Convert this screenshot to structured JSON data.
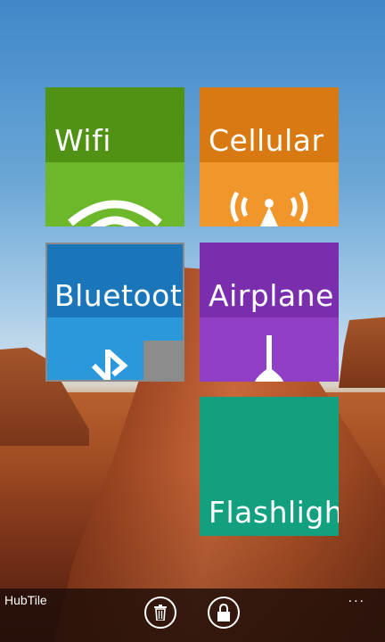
{
  "tiles": [
    {
      "label": "Wifi",
      "icon": "wifi-icon",
      "top_color": "#4f9214",
      "bottom_color": "#6cb82a"
    },
    {
      "label": "Cellular",
      "icon": "cellular-icon",
      "top_color": "#d97912",
      "bottom_color": "#f0962a"
    },
    {
      "label": "Bluetooth",
      "icon": "bluetooth-icon",
      "top_color": "#1a76b8",
      "bottom_color": "#2b98dc"
    },
    {
      "label": "Airplane",
      "icon": "airplane-icon",
      "top_color": "#7a2eae",
      "bottom_color": "#9140c6"
    },
    {
      "label": "Flashlight",
      "icon": "flashlight-icon",
      "color": "#12a07e"
    }
  ],
  "appbar": {
    "title": "HubTile",
    "more": "...",
    "buttons": [
      {
        "icon": "trash-icon"
      },
      {
        "icon": "lock-icon"
      }
    ]
  }
}
